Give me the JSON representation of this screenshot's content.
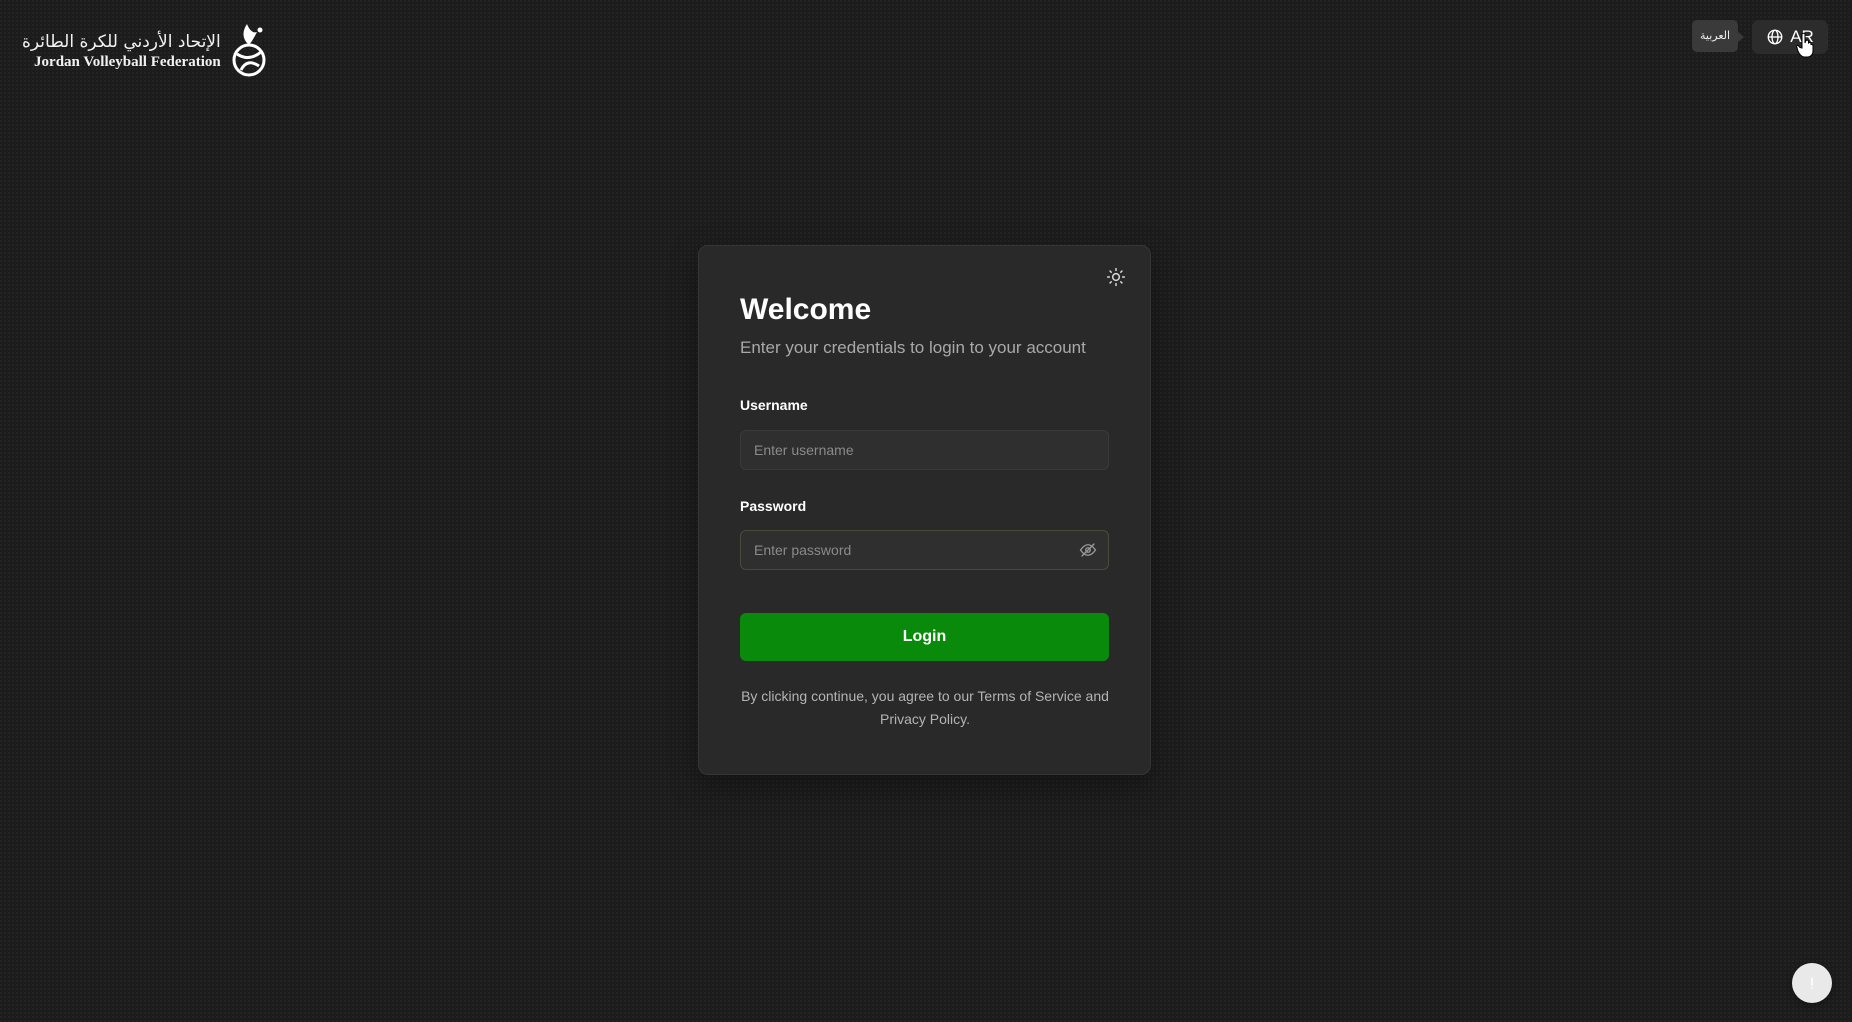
{
  "header": {
    "logo": {
      "arabic_text": "الإتحاد الأردني للكرة الطائرة",
      "english_text": "Jordan Volleyball Federation",
      "icon": "volleyball-emblem-icon"
    },
    "language_tooltip": "العربية",
    "language_button": {
      "label": "AR",
      "icon": "globe-icon"
    }
  },
  "login_card": {
    "theme_toggle_icon": "sun-icon",
    "title": "Welcome",
    "subtitle": "Enter your credentials to login to your account",
    "username": {
      "label": "Username",
      "placeholder": "Enter username",
      "value": ""
    },
    "password": {
      "label": "Password",
      "placeholder": "Enter password",
      "value": "",
      "toggle_icon": "eye-off-icon"
    },
    "login_button": "Login",
    "terms": {
      "prefix": "By clicking continue, you agree to our ",
      "terms_link": "Terms of Service",
      "middle": " and ",
      "privacy_link": "Privacy Policy",
      "suffix": "."
    }
  },
  "help_button_icon": "help-icon",
  "colors": {
    "background": "#1c1c1c",
    "card": "#292929",
    "accent_green": "#0a8a0a",
    "muted_text": "#a9a9a9"
  }
}
